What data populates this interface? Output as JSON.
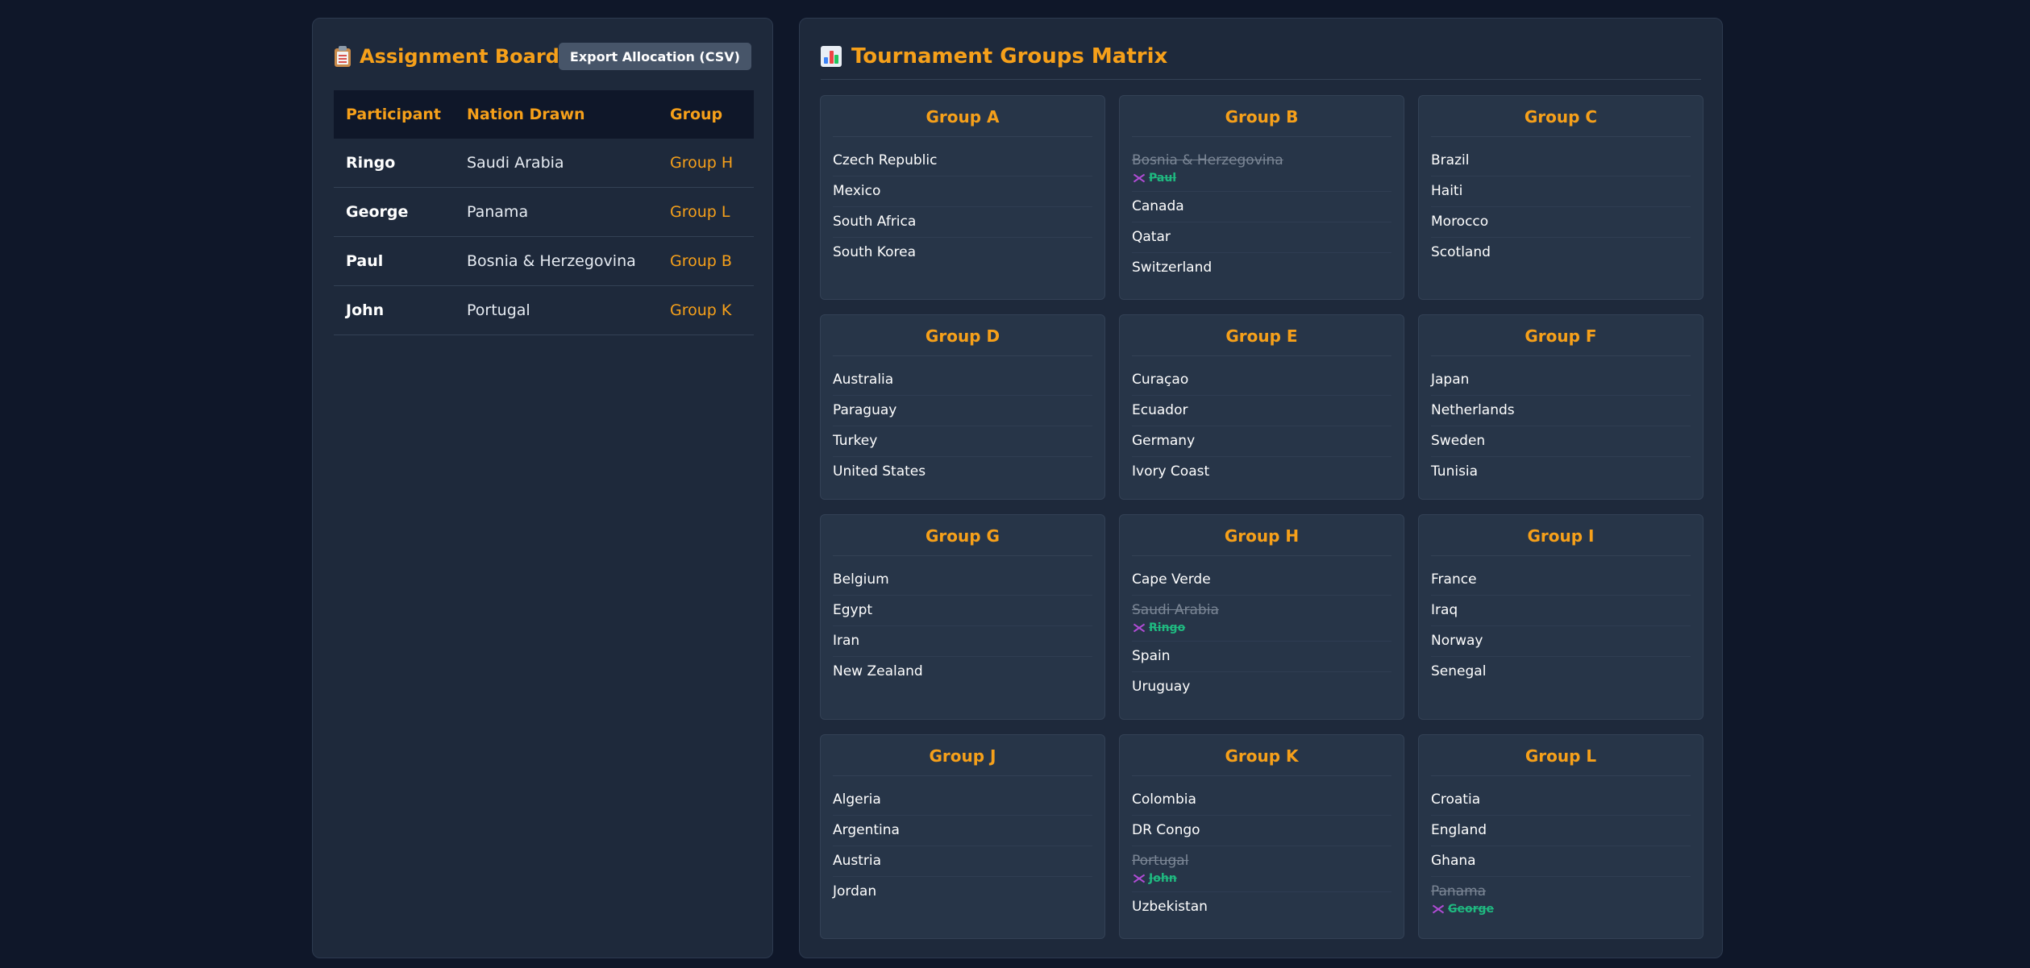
{
  "assignment_board": {
    "title": "Assignment Board",
    "icon": "clipboard-icon",
    "export_label": "Export Allocation (CSV)",
    "columns": [
      "Participant",
      "Nation Drawn",
      "Group"
    ],
    "rows": [
      {
        "participant": "Ringo",
        "nation": "Saudi Arabia",
        "group": "Group H"
      },
      {
        "participant": "George",
        "nation": "Panama",
        "group": "Group L"
      },
      {
        "participant": "Paul",
        "nation": "Bosnia & Herzegovina",
        "group": "Group B"
      },
      {
        "participant": "John",
        "nation": "Portugal",
        "group": "Group K"
      }
    ]
  },
  "matrix": {
    "title": "Tournament Groups Matrix",
    "icon": "bar-chart-icon",
    "groups": [
      {
        "name": "Group A",
        "teams": [
          {
            "name": "Czech Republic"
          },
          {
            "name": "Mexico"
          },
          {
            "name": "South Africa"
          },
          {
            "name": "South Korea"
          }
        ]
      },
      {
        "name": "Group B",
        "teams": [
          {
            "name": "Bosnia & Herzegovina",
            "owner": "Paul"
          },
          {
            "name": "Canada"
          },
          {
            "name": "Qatar"
          },
          {
            "name": "Switzerland"
          }
        ]
      },
      {
        "name": "Group C",
        "teams": [
          {
            "name": "Brazil"
          },
          {
            "name": "Haiti"
          },
          {
            "name": "Morocco"
          },
          {
            "name": "Scotland"
          }
        ]
      },
      {
        "name": "Group D",
        "teams": [
          {
            "name": "Australia"
          },
          {
            "name": "Paraguay"
          },
          {
            "name": "Turkey"
          },
          {
            "name": "United States"
          }
        ]
      },
      {
        "name": "Group E",
        "teams": [
          {
            "name": "Curaçao"
          },
          {
            "name": "Ecuador"
          },
          {
            "name": "Germany"
          },
          {
            "name": "Ivory Coast"
          }
        ]
      },
      {
        "name": "Group F",
        "teams": [
          {
            "name": "Japan"
          },
          {
            "name": "Netherlands"
          },
          {
            "name": "Sweden"
          },
          {
            "name": "Tunisia"
          }
        ]
      },
      {
        "name": "Group G",
        "teams": [
          {
            "name": "Belgium"
          },
          {
            "name": "Egypt"
          },
          {
            "name": "Iran"
          },
          {
            "name": "New Zealand"
          }
        ]
      },
      {
        "name": "Group H",
        "teams": [
          {
            "name": "Cape Verde"
          },
          {
            "name": "Saudi Arabia",
            "owner": "Ringo"
          },
          {
            "name": "Spain"
          },
          {
            "name": "Uruguay"
          }
        ]
      },
      {
        "name": "Group I",
        "teams": [
          {
            "name": "France"
          },
          {
            "name": "Iraq"
          },
          {
            "name": "Norway"
          },
          {
            "name": "Senegal"
          }
        ]
      },
      {
        "name": "Group J",
        "teams": [
          {
            "name": "Algeria"
          },
          {
            "name": "Argentina"
          },
          {
            "name": "Austria"
          },
          {
            "name": "Jordan"
          }
        ]
      },
      {
        "name": "Group K",
        "teams": [
          {
            "name": "Colombia"
          },
          {
            "name": "DR Congo"
          },
          {
            "name": "Portugal",
            "owner": "John"
          },
          {
            "name": "Uzbekistan"
          }
        ]
      },
      {
        "name": "Group L",
        "teams": [
          {
            "name": "Croatia"
          },
          {
            "name": "England"
          },
          {
            "name": "Ghana"
          },
          {
            "name": "Panama",
            "owner": "George"
          }
        ]
      }
    ]
  },
  "colors": {
    "accent": "#f6a01a",
    "owner": "#1fb980",
    "background": "#0f1729",
    "panel": "#1e293b"
  }
}
